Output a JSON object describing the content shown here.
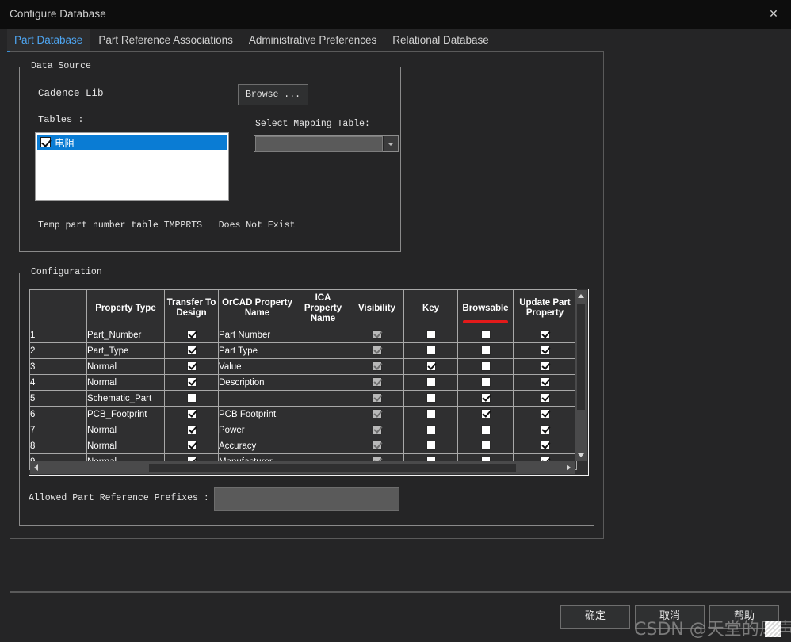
{
  "window": {
    "title": "Configure Database",
    "close_icon": "close-icon"
  },
  "tabs": [
    {
      "label": "Part Database",
      "active": true
    },
    {
      "label": "Part Reference Associations",
      "active": false
    },
    {
      "label": "Administrative Preferences",
      "active": false
    },
    {
      "label": "Relational Database",
      "active": false
    }
  ],
  "data_source": {
    "legend": "Data Source",
    "source_name": "Cadence_Lib",
    "browse_label": "Browse ...",
    "tables_label": "Tables :",
    "tables": [
      {
        "label": "电阻",
        "checked": true,
        "selected": true
      }
    ],
    "temp_table_text": "Temp part number table TMPPRTS",
    "temp_table_status": "Does Not Exist",
    "mapping_label": "Select Mapping Table:",
    "mapping_value": "",
    "mapping_arrow_icon": "chevron-down-icon"
  },
  "configuration": {
    "legend": "Configuration",
    "columns": [
      "",
      "Property Type",
      "Transfer To Design",
      "OrCAD Property Name",
      "ICA Property Name",
      "Visibility",
      "Key",
      "Browsable",
      "Update Part Property"
    ],
    "highlight_column": "Browsable",
    "highlight_color": "#e31a1a",
    "rows": [
      {
        "num": "1",
        "property_type": "Part_Number",
        "transfer": true,
        "orcad_name": "Part Number",
        "ica_name": "",
        "visibility": true,
        "key": false,
        "browsable": false,
        "update": true
      },
      {
        "num": "2",
        "property_type": "Part_Type",
        "transfer": true,
        "orcad_name": "Part Type",
        "ica_name": "",
        "visibility": true,
        "key": false,
        "browsable": false,
        "update": true
      },
      {
        "num": "3",
        "property_type": "Normal",
        "transfer": true,
        "orcad_name": "Value",
        "ica_name": "",
        "visibility": true,
        "key": true,
        "browsable": false,
        "update": true
      },
      {
        "num": "4",
        "property_type": "Normal",
        "transfer": true,
        "orcad_name": "Description",
        "ica_name": "",
        "visibility": true,
        "key": false,
        "browsable": false,
        "update": true
      },
      {
        "num": "5",
        "property_type": "Schematic_Part",
        "transfer": false,
        "orcad_name": "",
        "ica_name": "",
        "visibility": true,
        "key": false,
        "browsable": true,
        "update": true
      },
      {
        "num": "6",
        "property_type": "PCB_Footprint",
        "transfer": true,
        "orcad_name": "PCB Footprint",
        "ica_name": "",
        "visibility": true,
        "key": false,
        "browsable": true,
        "update": true
      },
      {
        "num": "7",
        "property_type": "Normal",
        "transfer": true,
        "orcad_name": "Power",
        "ica_name": "",
        "visibility": true,
        "key": false,
        "browsable": false,
        "update": true
      },
      {
        "num": "8",
        "property_type": "Normal",
        "transfer": true,
        "orcad_name": "Accuracy",
        "ica_name": "",
        "visibility": true,
        "key": false,
        "browsable": false,
        "update": true
      },
      {
        "num": "9",
        "property_type": "Normal",
        "transfer": true,
        "orcad_name": "Manufacturer",
        "ica_name": "",
        "visibility": true,
        "key": false,
        "browsable": false,
        "update": true
      }
    ],
    "prefix_label": "Allowed Part Reference Prefixes :",
    "prefix_value": ""
  },
  "footer": {
    "ok_label": "确定",
    "cancel_label": "取消",
    "help_label": "帮助"
  },
  "watermark": {
    "text": "CSDN @天堂的风声"
  }
}
